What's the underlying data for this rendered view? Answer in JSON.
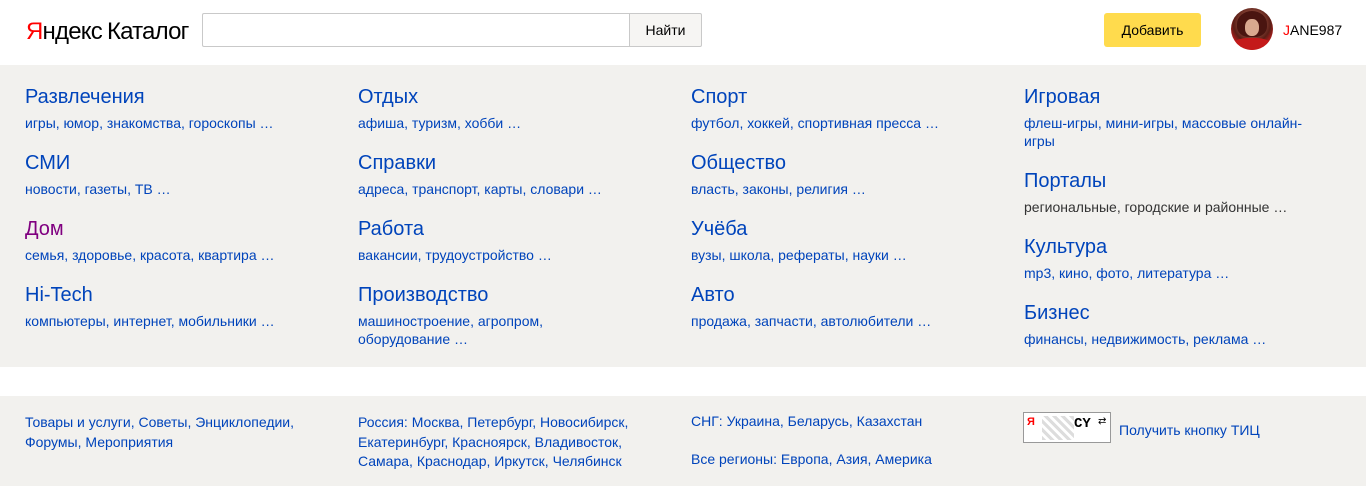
{
  "header": {
    "logo_ya": "Я",
    "logo_ndex": "ндекс",
    "logo_catalog": "Каталог",
    "search_value": "",
    "search_button": "Найти",
    "add_button": "Добавить",
    "user_first": "J",
    "user_rest": "ANE987"
  },
  "catalog": {
    "columns": [
      [
        {
          "title": "Развлечения",
          "sub": "игры, юмор, знакомства, гороскопы …",
          "visited": false
        },
        {
          "title": "СМИ",
          "sub": "новости, газеты, ТВ …",
          "visited": false
        },
        {
          "title": "Дом",
          "sub": "семья, здоровье, красота, квартира …",
          "visited": true
        },
        {
          "title": "Hi-Tech",
          "sub": "компьютеры, интернет, мобильники …",
          "visited": false
        }
      ],
      [
        {
          "title": "Отдых",
          "sub": "афиша, туризм, хобби …",
          "visited": false
        },
        {
          "title": "Справки",
          "sub": "адреса, транспорт, карты, словари …",
          "visited": false
        },
        {
          "title": "Работа",
          "sub": "вакансии, трудоустройство …",
          "visited": false
        },
        {
          "title": "Производство",
          "sub": "машиностроение, агропром, оборудование …",
          "visited": false
        }
      ],
      [
        {
          "title": "Спорт",
          "sub": "футбол, хоккей, спортивная пресса …",
          "visited": false
        },
        {
          "title": "Общество",
          "sub": "власть, законы, религия …",
          "visited": false
        },
        {
          "title": "Учёба",
          "sub": "вузы, школа, рефераты, науки …",
          "visited": false
        },
        {
          "title": "Авто",
          "sub": "продажа, запчасти, автолюбители …",
          "visited": false
        }
      ],
      [
        {
          "title": "Игровая",
          "sub": "флеш-игры, мини-игры, массовые онлайн-игры",
          "visited": false
        },
        {
          "title": "Порталы",
          "sub": "региональные, городские и районные …",
          "visited": false
        },
        {
          "title": "Культура",
          "sub": "mp3, кино, фото, литература …",
          "visited": false
        },
        {
          "title": "Бизнес",
          "sub": "финансы, недвижимость, реклама …",
          "visited": false
        }
      ]
    ]
  },
  "footer": {
    "col1_line1": "Товары и услуги, Советы, Энциклопедии,",
    "col1_line2": "Форумы, Мероприятия",
    "col2_line1": "Россия: Москва, Петербург, Новосибирск,",
    "col2_line2": "Екатеринбург, Красноярск, Владивосток,",
    "col2_line3": "Самара, Краснодар, Иркутск, Челябинск",
    "col3_line1": "СНГ: Украина, Беларусь, Казахстан",
    "col3_line2": "Все регионы: Европа, Азия, Америка",
    "tic_badge_ya": "Я",
    "tic_badge_cy": "CY",
    "tic_link": "Получить кнопку ТИЦ"
  }
}
